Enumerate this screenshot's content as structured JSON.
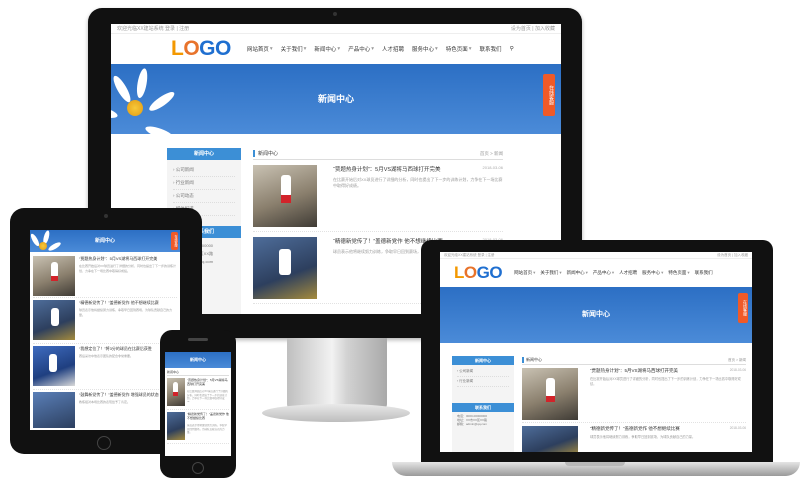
{
  "site": {
    "topbar_left": "欢迎光临XX建站系统 登录 | 注册",
    "topbar_right": "设为首页 | 加入收藏",
    "logo": {
      "part1": "L",
      "part2": "O",
      "part3": "GO"
    },
    "nav": [
      "网站首页",
      "关于我们",
      "新闻中心",
      "产品中心",
      "人才招聘",
      "服务中心",
      "特色页面",
      "联系我们"
    ],
    "banner_title": "新闻中心",
    "float_button": "在线客服",
    "sidebar_title": "新闻中心",
    "sidebar_items": [
      "公司新闻",
      "行业新闻",
      "公司动态",
      "媒体报道"
    ],
    "sidebar_contact_title": "联系我们",
    "sidebar_contact": [
      "电话：0000-00000000",
      "地址：XX市XX区XX路",
      "邮箱：admin@qq.com"
    ],
    "content_head": "新闻中心",
    "breadcrumb": "首页 > 新闻",
    "news": [
      {
        "title": "“贾题热身计划”：5月VS湖将马西球打开完美",
        "date": "2018-03-06",
        "desc": "在比赛开始后对XX球员进行了详细的分析，同时也提出了下一步的训练计划，力争在下一场比赛中取得好成绩。"
      },
      {
        "title": "“精德新党传了！”盖德新党作 他不想继续比赛",
        "date": "2018-03-06",
        "desc": "球员表示他将继续努力训练，争取早日回到赛场，为球队贡献自己的力量。"
      },
      {
        "title": "“我想定位了！”将3分的球员在比赛后获胜",
        "date": "2018-03-06",
        "desc": "赛后采访中他表示团队的配合非常重要。"
      },
      {
        "title": "“鼓舞新党传了！”盖德新党作 增强球员的状态",
        "date": "2018-03-06",
        "desc": "教练组对本场比赛的表现给予了肯定。"
      }
    ]
  }
}
